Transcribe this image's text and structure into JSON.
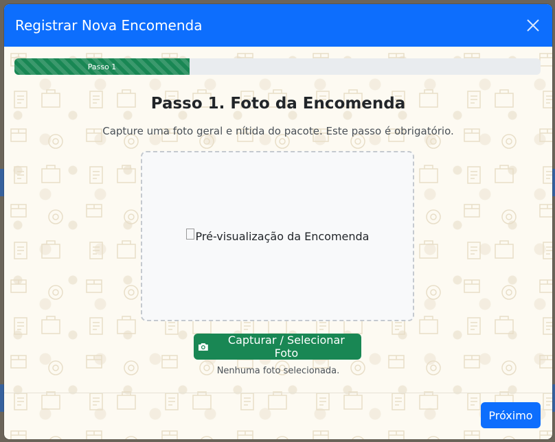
{
  "modal": {
    "title": "Registrar Nova Encomenda",
    "close_icon": "close-icon"
  },
  "progress": {
    "label": "Passo 1",
    "fraction": 0.333,
    "color": "#198754"
  },
  "step": {
    "title": "Passo 1. Foto da Encomenda",
    "description": "Capture uma foto geral e nítida do pacote. Este passo é obrigatório."
  },
  "preview": {
    "alt_text": "Pré-visualização da Encomenda"
  },
  "capture": {
    "icon": "camera-icon",
    "label": "Capturar / Selecionar Foto",
    "status": "Nenhuma foto selecionada."
  },
  "footer": {
    "next_label": "Próximo"
  },
  "colors": {
    "header": "#0d6efd",
    "success": "#198754",
    "primary": "#0d6efd"
  }
}
